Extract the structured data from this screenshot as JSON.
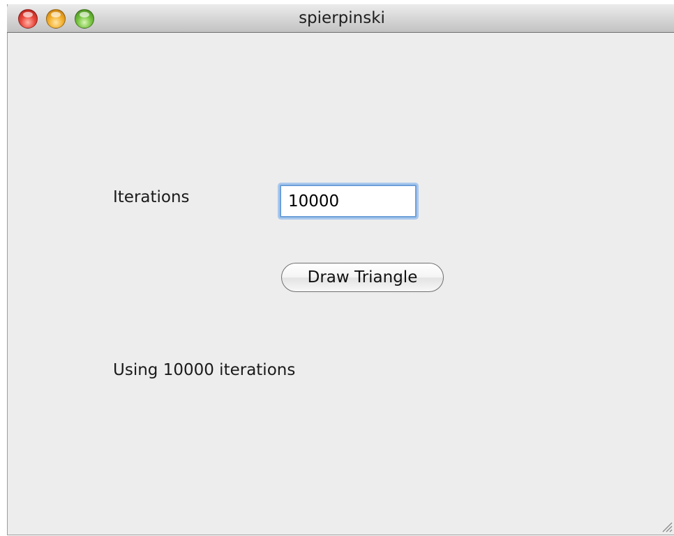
{
  "window": {
    "title": "spierpinski"
  },
  "form": {
    "iterations_label": "Iterations",
    "iterations_value": "10000",
    "draw_button_label": "Draw Triangle",
    "status_text": "Using 10000 iterations"
  },
  "icons": {
    "close": "close-icon",
    "minimize": "minimize-icon",
    "zoom": "zoom-icon",
    "resize": "resize-grip-icon"
  },
  "colors": {
    "window_bg": "#ededed",
    "focus_ring": "#6c9fd9"
  }
}
